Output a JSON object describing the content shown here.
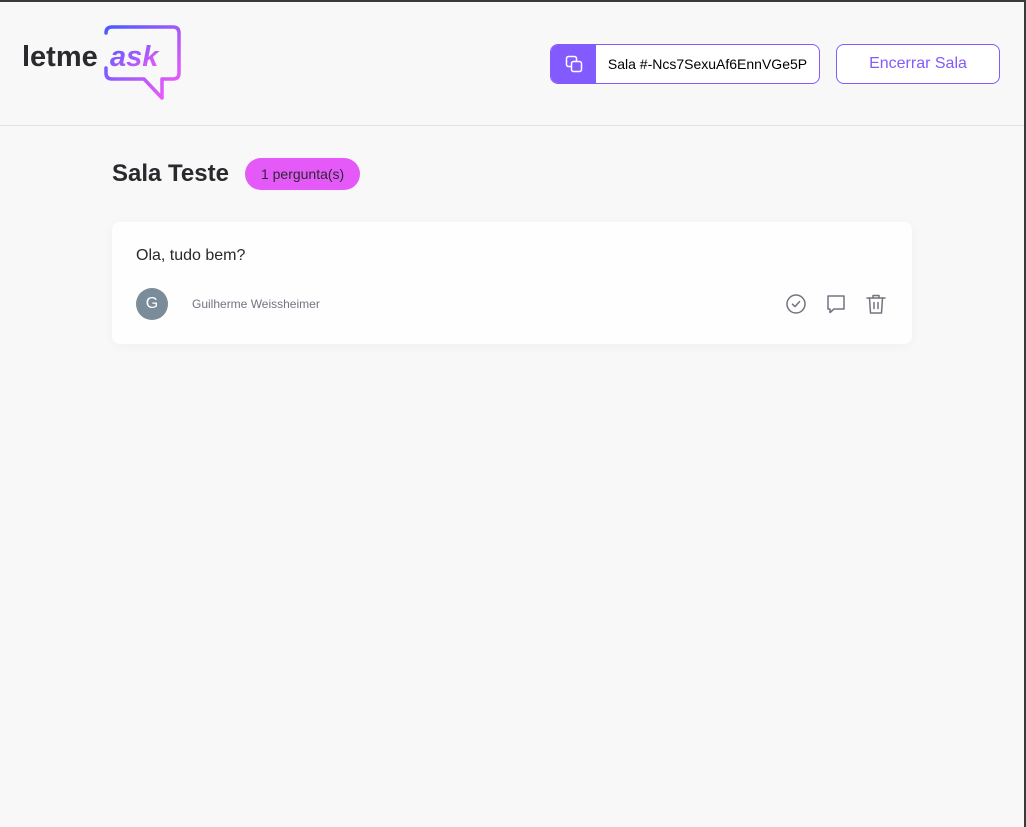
{
  "header": {
    "logo": {
      "text_plain": "letme",
      "text_accent": "ask"
    },
    "room_code": {
      "label": "Sala #-Ncs7SexuAf6EnnVGe5P",
      "icon": "copy-icon"
    },
    "end_button": {
      "label": "Encerrar Sala"
    }
  },
  "room": {
    "title": "Sala Teste",
    "question_count": "1 pergunta(s)"
  },
  "questions": [
    {
      "content": "Ola, tudo bem?",
      "author": {
        "initial": "G",
        "name": "Guilherme Weissheimer"
      },
      "actions": [
        "check-circle-icon",
        "answer-icon",
        "trash-icon"
      ]
    }
  ],
  "colors": {
    "purple": "#835afd",
    "pink": "#e559f9",
    "background": "#f8f8f8",
    "text": "#29292e"
  }
}
